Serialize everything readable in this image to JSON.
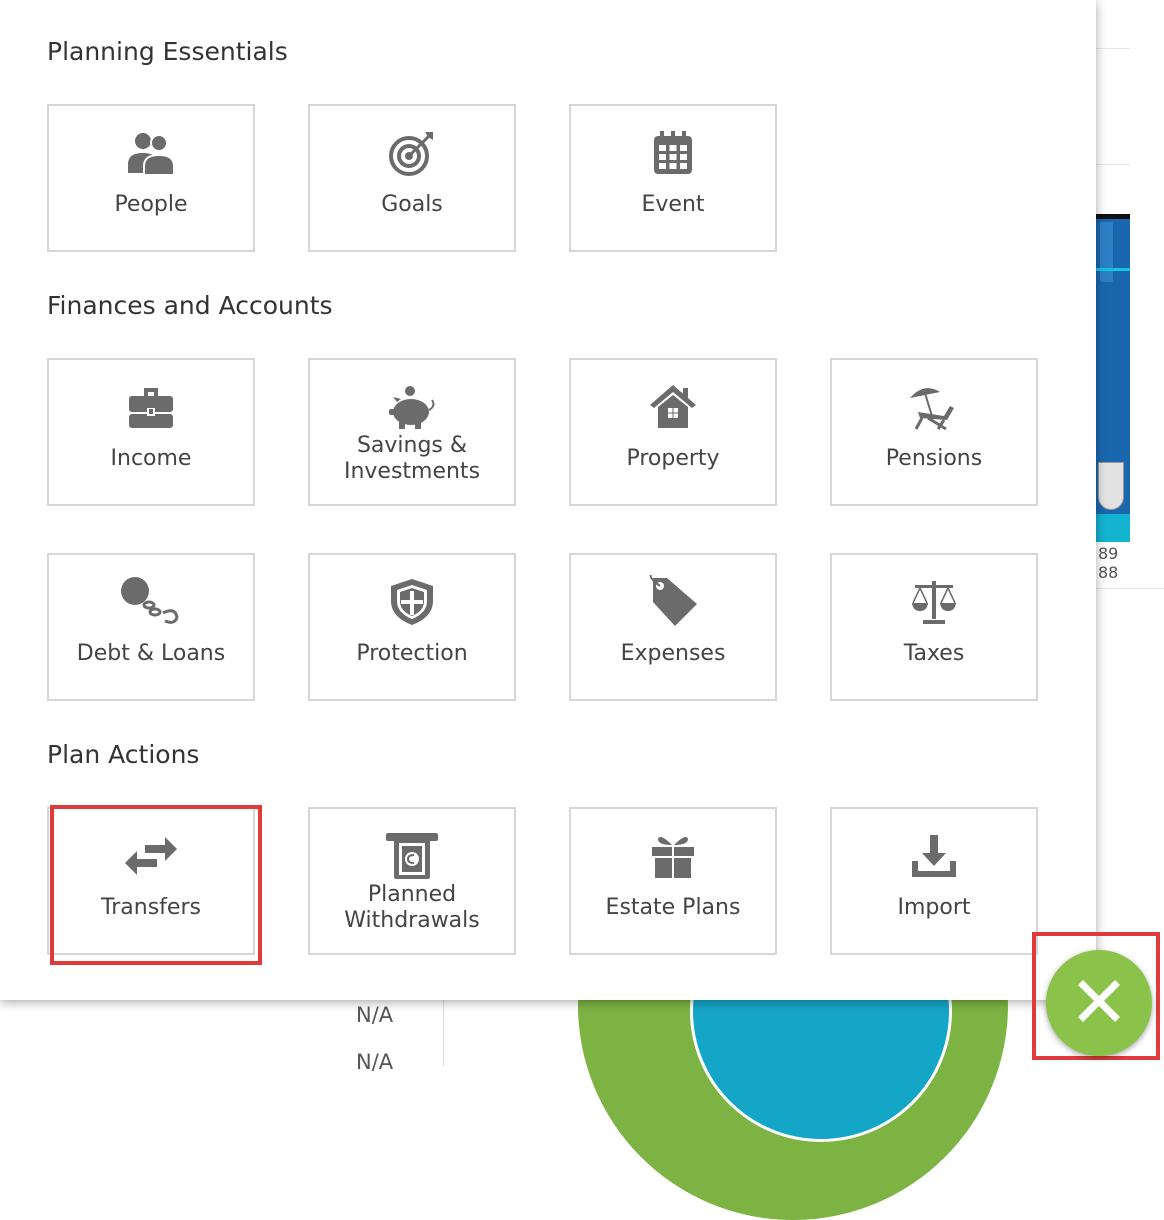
{
  "background": {
    "chart_labels": [
      "89",
      "88"
    ],
    "table_values": [
      "N/A",
      "N/A"
    ],
    "colors": {
      "donut_outer": "#7cb342",
      "donut_inner": "#14a6c6",
      "bar": "#1b67ad"
    }
  },
  "menu": {
    "sections": [
      {
        "title": "Planning Essentials",
        "tiles": [
          {
            "label": "People",
            "icon": "people-icon"
          },
          {
            "label": "Goals",
            "icon": "target-icon"
          },
          {
            "label": "Event",
            "icon": "calendar-icon"
          }
        ]
      },
      {
        "title": "Finances and Accounts",
        "tiles": [
          {
            "label": "Income",
            "icon": "briefcase-icon"
          },
          {
            "label": "Savings &\nInvestments",
            "icon": "piggy-bank-icon"
          },
          {
            "label": "Property",
            "icon": "house-icon"
          },
          {
            "label": "Pensions",
            "icon": "beach-chair-icon"
          },
          {
            "label": "Debt & Loans",
            "icon": "ball-and-chain-icon"
          },
          {
            "label": "Protection",
            "icon": "shield-icon"
          },
          {
            "label": "Expenses",
            "icon": "price-tag-icon"
          },
          {
            "label": "Taxes",
            "icon": "scales-icon"
          }
        ]
      },
      {
        "title": "Plan Actions",
        "tiles": [
          {
            "label": "Transfers",
            "icon": "transfer-arrows-icon"
          },
          {
            "label": "Planned\nWithdrawals",
            "icon": "atm-withdrawal-icon"
          },
          {
            "label": "Estate Plans",
            "icon": "gift-icon"
          },
          {
            "label": "Import",
            "icon": "download-icon"
          }
        ]
      }
    ]
  },
  "close_button": {
    "icon": "close-icon",
    "color": "#8bc34a"
  },
  "highlight_color": "#e03a3a"
}
